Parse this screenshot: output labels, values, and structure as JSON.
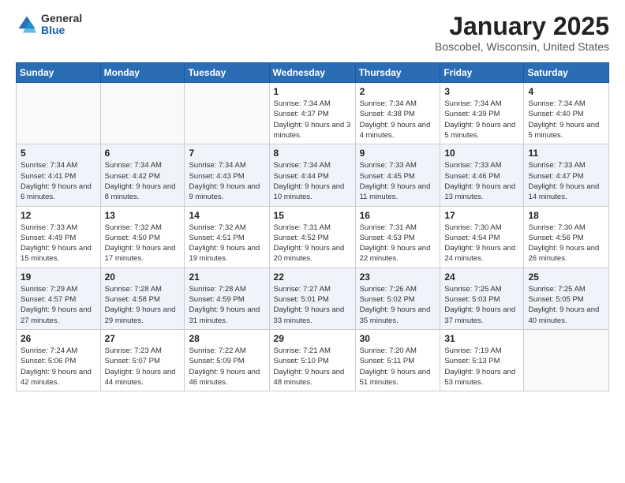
{
  "header": {
    "logo_general": "General",
    "logo_blue": "Blue",
    "month": "January 2025",
    "location": "Boscobel, Wisconsin, United States"
  },
  "days_of_week": [
    "Sunday",
    "Monday",
    "Tuesday",
    "Wednesday",
    "Thursday",
    "Friday",
    "Saturday"
  ],
  "weeks": [
    [
      {
        "day": "",
        "info": ""
      },
      {
        "day": "",
        "info": ""
      },
      {
        "day": "",
        "info": ""
      },
      {
        "day": "1",
        "info": "Sunrise: 7:34 AM\nSunset: 4:37 PM\nDaylight: 9 hours and 3 minutes."
      },
      {
        "day": "2",
        "info": "Sunrise: 7:34 AM\nSunset: 4:38 PM\nDaylight: 9 hours and 4 minutes."
      },
      {
        "day": "3",
        "info": "Sunrise: 7:34 AM\nSunset: 4:39 PM\nDaylight: 9 hours and 5 minutes."
      },
      {
        "day": "4",
        "info": "Sunrise: 7:34 AM\nSunset: 4:40 PM\nDaylight: 9 hours and 5 minutes."
      }
    ],
    [
      {
        "day": "5",
        "info": "Sunrise: 7:34 AM\nSunset: 4:41 PM\nDaylight: 9 hours and 6 minutes."
      },
      {
        "day": "6",
        "info": "Sunrise: 7:34 AM\nSunset: 4:42 PM\nDaylight: 9 hours and 8 minutes."
      },
      {
        "day": "7",
        "info": "Sunrise: 7:34 AM\nSunset: 4:43 PM\nDaylight: 9 hours and 9 minutes."
      },
      {
        "day": "8",
        "info": "Sunrise: 7:34 AM\nSunset: 4:44 PM\nDaylight: 9 hours and 10 minutes."
      },
      {
        "day": "9",
        "info": "Sunrise: 7:33 AM\nSunset: 4:45 PM\nDaylight: 9 hours and 11 minutes."
      },
      {
        "day": "10",
        "info": "Sunrise: 7:33 AM\nSunset: 4:46 PM\nDaylight: 9 hours and 13 minutes."
      },
      {
        "day": "11",
        "info": "Sunrise: 7:33 AM\nSunset: 4:47 PM\nDaylight: 9 hours and 14 minutes."
      }
    ],
    [
      {
        "day": "12",
        "info": "Sunrise: 7:33 AM\nSunset: 4:49 PM\nDaylight: 9 hours and 15 minutes."
      },
      {
        "day": "13",
        "info": "Sunrise: 7:32 AM\nSunset: 4:50 PM\nDaylight: 9 hours and 17 minutes."
      },
      {
        "day": "14",
        "info": "Sunrise: 7:32 AM\nSunset: 4:51 PM\nDaylight: 9 hours and 19 minutes."
      },
      {
        "day": "15",
        "info": "Sunrise: 7:31 AM\nSunset: 4:52 PM\nDaylight: 9 hours and 20 minutes."
      },
      {
        "day": "16",
        "info": "Sunrise: 7:31 AM\nSunset: 4:53 PM\nDaylight: 9 hours and 22 minutes."
      },
      {
        "day": "17",
        "info": "Sunrise: 7:30 AM\nSunset: 4:54 PM\nDaylight: 9 hours and 24 minutes."
      },
      {
        "day": "18",
        "info": "Sunrise: 7:30 AM\nSunset: 4:56 PM\nDaylight: 9 hours and 26 minutes."
      }
    ],
    [
      {
        "day": "19",
        "info": "Sunrise: 7:29 AM\nSunset: 4:57 PM\nDaylight: 9 hours and 27 minutes."
      },
      {
        "day": "20",
        "info": "Sunrise: 7:28 AM\nSunset: 4:58 PM\nDaylight: 9 hours and 29 minutes."
      },
      {
        "day": "21",
        "info": "Sunrise: 7:28 AM\nSunset: 4:59 PM\nDaylight: 9 hours and 31 minutes."
      },
      {
        "day": "22",
        "info": "Sunrise: 7:27 AM\nSunset: 5:01 PM\nDaylight: 9 hours and 33 minutes."
      },
      {
        "day": "23",
        "info": "Sunrise: 7:26 AM\nSunset: 5:02 PM\nDaylight: 9 hours and 35 minutes."
      },
      {
        "day": "24",
        "info": "Sunrise: 7:25 AM\nSunset: 5:03 PM\nDaylight: 9 hours and 37 minutes."
      },
      {
        "day": "25",
        "info": "Sunrise: 7:25 AM\nSunset: 5:05 PM\nDaylight: 9 hours and 40 minutes."
      }
    ],
    [
      {
        "day": "26",
        "info": "Sunrise: 7:24 AM\nSunset: 5:06 PM\nDaylight: 9 hours and 42 minutes."
      },
      {
        "day": "27",
        "info": "Sunrise: 7:23 AM\nSunset: 5:07 PM\nDaylight: 9 hours and 44 minutes."
      },
      {
        "day": "28",
        "info": "Sunrise: 7:22 AM\nSunset: 5:09 PM\nDaylight: 9 hours and 46 minutes."
      },
      {
        "day": "29",
        "info": "Sunrise: 7:21 AM\nSunset: 5:10 PM\nDaylight: 9 hours and 48 minutes."
      },
      {
        "day": "30",
        "info": "Sunrise: 7:20 AM\nSunset: 5:11 PM\nDaylight: 9 hours and 51 minutes."
      },
      {
        "day": "31",
        "info": "Sunrise: 7:19 AM\nSunset: 5:13 PM\nDaylight: 9 hours and 53 minutes."
      },
      {
        "day": "",
        "info": ""
      }
    ]
  ]
}
